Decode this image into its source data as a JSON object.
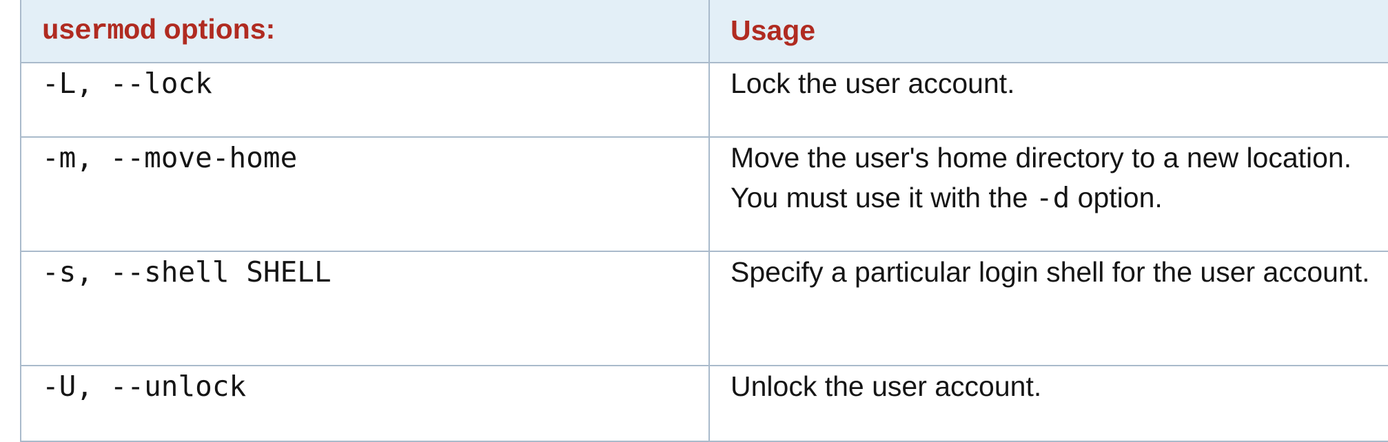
{
  "table": {
    "header": {
      "options_cmd": "usermod",
      "options_suffix": " options:",
      "usage": "Usage"
    },
    "rows": [
      {
        "option": "-L, --lock",
        "usage": "Lock the user account."
      },
      {
        "option": "-m, --move-home",
        "usage_before": "Move the user's home directory to a new location. You must use it with the ",
        "usage_code": "-d",
        "usage_after": " option."
      },
      {
        "option": "-s, --shell SHELL",
        "usage": "Specify a particular login shell for the user account."
      },
      {
        "option": "-U, --unlock",
        "usage": "Unlock the user account."
      }
    ]
  },
  "colors": {
    "header_background": "#e3eff7",
    "header_text": "#b02b21",
    "border": "#a9bacb",
    "body_text": "#151515"
  }
}
